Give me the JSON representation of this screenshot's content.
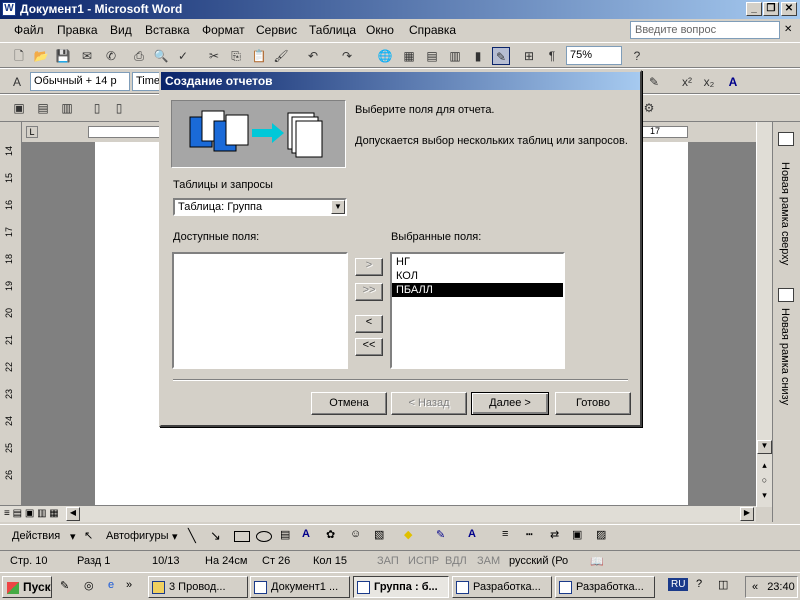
{
  "window": {
    "title": "Документ1 - Microsoft Word",
    "min": "_",
    "max": "❐",
    "close": "✕"
  },
  "menu": {
    "items": [
      "Файл",
      "Правка",
      "Вид",
      "Вставка",
      "Формат",
      "Сервис",
      "Таблица",
      "Окно",
      "Справка"
    ],
    "help_placeholder": "Введите вопрос"
  },
  "toolbar": {
    "zoom": "75%",
    "style": "Обычный + 14 р",
    "font": "Time"
  },
  "ruler": {
    "left_marks": [
      "14",
      "15",
      "16",
      "17",
      "18",
      "19",
      "20",
      "21",
      "22",
      "23",
      "24",
      "25",
      "26"
    ],
    "top_right_mark": "17"
  },
  "taskpane": {
    "item1": "Новая рамка сверху",
    "item2": "Новая рамка снизу"
  },
  "dialog": {
    "title": "Создание отчетов",
    "intro1": "Выберите поля для отчета.",
    "intro2": "Допускается выбор нескольких таблиц или запросов.",
    "tables_label": "Таблицы и запросы",
    "tables_value": "Таблица: Группа",
    "available_label": "Доступные поля:",
    "selected_label": "Выбранные поля:",
    "selected_fields": [
      "НГ",
      "КОЛ",
      "ПБАЛЛ"
    ],
    "selected_index": 2,
    "move_one": ">",
    "move_all": ">>",
    "remove_one": "<",
    "remove_all": "<<",
    "cancel": "Отмена",
    "back": "< Назад",
    "next": "Далее >",
    "finish": "Готово"
  },
  "drawbar": {
    "actions": "Действия",
    "autoshapes": "Автофигуры"
  },
  "status": {
    "page": "Стр. 10",
    "section": "Разд 1",
    "pages": "10/13",
    "at": "На 24см",
    "line": "Ст 26",
    "col": "Кол 15",
    "rec": "ЗАП",
    "trk": "ИСПР",
    "ext": "ВДЛ",
    "ovr": "ЗАМ",
    "lang": "русский (Ро"
  },
  "taskbar": {
    "start": "Пуск",
    "tasks": [
      "3 Провод...",
      "Документ1 ...",
      "Группа : б...",
      "Разработка...",
      "Разработка..."
    ],
    "active_index": 2,
    "lang": "RU",
    "clock": "23:40"
  },
  "colors": {
    "title_start": "#0a246a",
    "title_end": "#a6caf0",
    "face": "#d4d0c8"
  }
}
